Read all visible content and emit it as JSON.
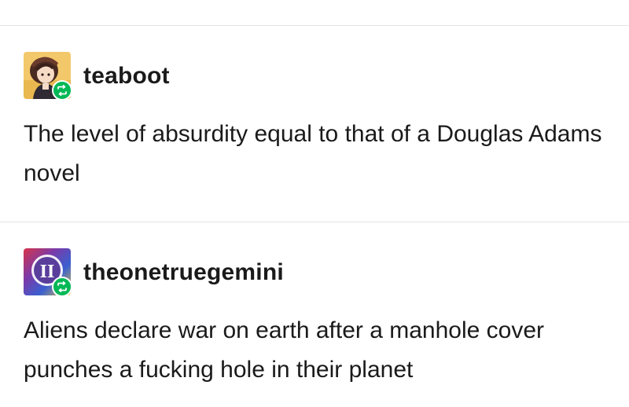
{
  "posts": [
    {
      "username": "teaboot",
      "avatar_icon": "anime-character-avatar-icon",
      "badge_icon": "reblog-icon",
      "text": "The level of absurdity equal to that of a Douglas Adams novel"
    },
    {
      "username": "theonetruegemini",
      "avatar_icon": "gemini-symbol-avatar-icon",
      "avatar_glyph": "II",
      "badge_icon": "reblog-icon",
      "text": "Aliens declare war on earth after a manhole cover punches a fucking hole in their planet"
    }
  ],
  "colors": {
    "reblog_badge": "#00b856",
    "divider": "#e4e4e4",
    "text": "#1a1a1a"
  }
}
